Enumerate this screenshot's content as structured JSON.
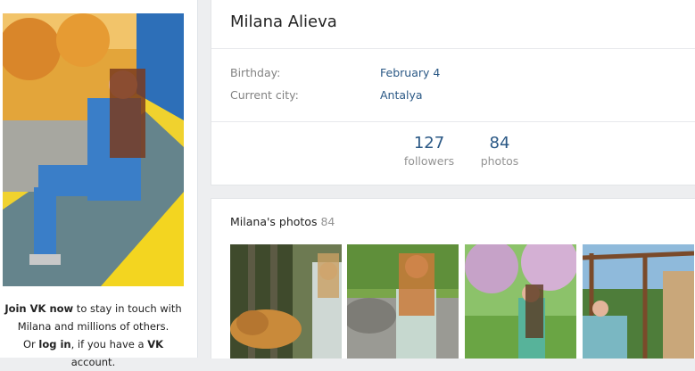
{
  "join": {
    "line1_bold": "Join VK now",
    "line1_rest": " to stay in touch with",
    "line2": "Milana and millions of others.",
    "line3_a": "Or ",
    "line3_link": "log in",
    "line3_b": ", if you have a ",
    "line3_vk": "VK",
    "line3_c": " account."
  },
  "profile": {
    "name": "Milana Alieva",
    "info": [
      {
        "label": "Birthday:",
        "value": "February 4"
      },
      {
        "label": "Current city:",
        "value": "Antalya"
      }
    ],
    "counters": [
      {
        "number": "127",
        "label": "followers"
      },
      {
        "number": "84",
        "label": "photos"
      }
    ]
  },
  "photos": {
    "title": "Milana's photos",
    "count": "84"
  },
  "colors": {
    "link": "#2a5885",
    "background": "#edeef0",
    "muted": "#828282"
  }
}
